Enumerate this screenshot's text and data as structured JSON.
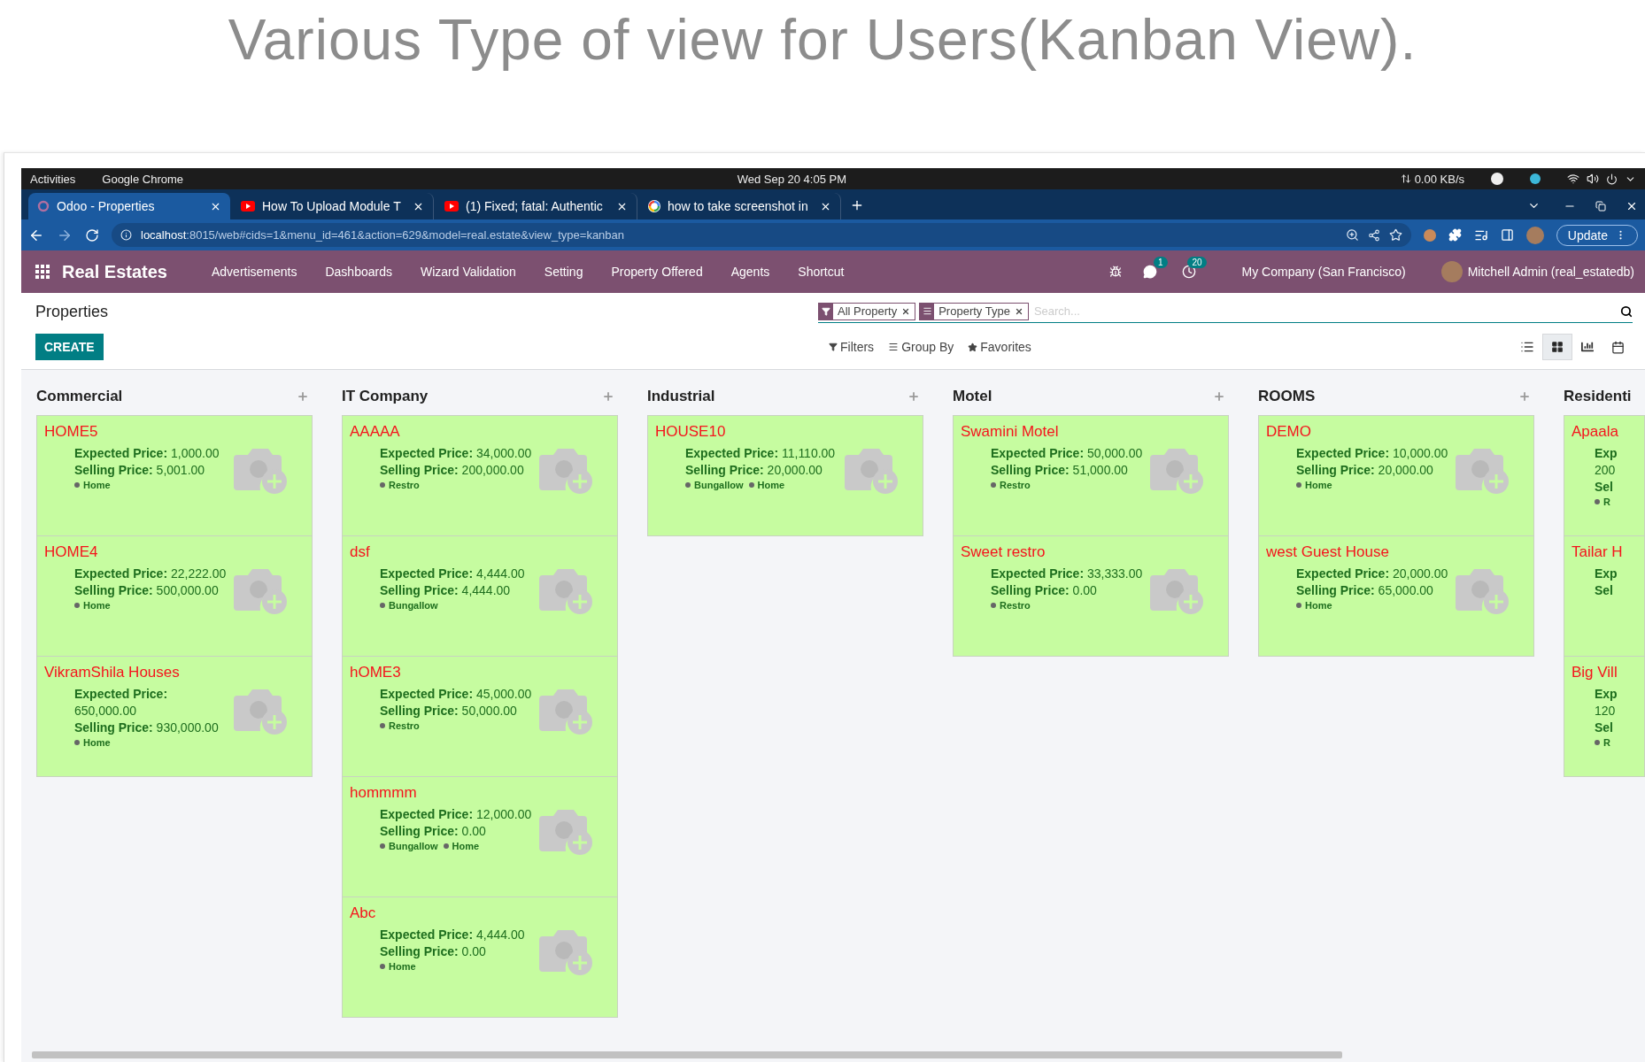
{
  "heading": "Various Type of view for Users(Kanban View).",
  "system_bar": {
    "activities": "Activities",
    "app": "Google Chrome",
    "datetime": "Wed Sep 20  4:05 PM",
    "network": "0.00 KB/s"
  },
  "browser_tabs": [
    {
      "title": "Odoo - Properties",
      "kind": "odoo",
      "selected": true
    },
    {
      "title": "How To Upload Module T",
      "kind": "youtube",
      "selected": false
    },
    {
      "title": "(1) Fixed; fatal: Authentic",
      "kind": "youtube",
      "selected": false
    },
    {
      "title": "how to take screenshot in",
      "kind": "google",
      "selected": false
    }
  ],
  "address": {
    "host": "localhost",
    "rest": ":8015/web#cids=1&menu_id=461&action=629&model=real.estate&view_type=kanban"
  },
  "update_button": "Update",
  "navbar": {
    "brand": "Real Estates",
    "menu": [
      "Advertisements",
      "Dashboards",
      "Wizard Validation",
      "Setting",
      "Property Offered",
      "Agents",
      "Shortcut"
    ],
    "messages_badge": "1",
    "activities_badge": "20",
    "company": "My Company (San Francisco)",
    "user": "Mitchell Admin (real_estatedb)"
  },
  "control_panel": {
    "breadcrumb": "Properties",
    "create": "CREATE",
    "facets": [
      {
        "kind": "filter",
        "label": "All Property"
      },
      {
        "kind": "group",
        "label": "Property Type"
      }
    ],
    "search": {
      "placeholder": "Search..."
    },
    "options": [
      {
        "kind": "filter",
        "label": "Filters"
      },
      {
        "kind": "group",
        "label": "Group By"
      },
      {
        "kind": "favorite",
        "label": "Favorites"
      }
    ],
    "views": [
      {
        "kind": "list",
        "selected": false
      },
      {
        "kind": "kanban",
        "selected": true
      },
      {
        "kind": "graph",
        "selected": false
      },
      {
        "kind": "calendar",
        "selected": false
      }
    ]
  },
  "columns": [
    {
      "title": "Commercial",
      "add_button": true,
      "cards": [
        {
          "name": "HOME5",
          "expected": {
            "label": "Expected Price:",
            "value": "1,000.00"
          },
          "selling": {
            "label": "Selling Price:",
            "value": "5,001.00"
          },
          "tags": [
            "Home"
          ],
          "photo_placeholder": true
        },
        {
          "name": "HOME4",
          "expected": {
            "label": "Expected Price:",
            "value": "22,222.00"
          },
          "selling": {
            "label": "Selling Price:",
            "value": "500,000.00"
          },
          "tags": [
            "Home"
          ],
          "photo_placeholder": true
        },
        {
          "name": "VikramShila Houses",
          "expected": {
            "label": "Expected Price:",
            "value": "650,000.00",
            "wrapped": true
          },
          "selling": {
            "label": "Selling Price:",
            "value": "930,000.00"
          },
          "tags": [
            "Home"
          ],
          "photo_placeholder": true
        }
      ]
    },
    {
      "title": "IT Company",
      "add_button": true,
      "cards": [
        {
          "name": "AAAAA",
          "expected": {
            "label": "Expected Price:",
            "value": "34,000.00"
          },
          "selling": {
            "label": "Selling Price:",
            "value": "200,000.00"
          },
          "tags": [
            "Restro"
          ],
          "photo_placeholder": true
        },
        {
          "name": "dsf",
          "expected": {
            "label": "Expected Price:",
            "value": "4,444.00"
          },
          "selling": {
            "label": "Selling Price:",
            "value": "4,444.00"
          },
          "tags": [
            "Bungallow"
          ],
          "photo_placeholder": true
        },
        {
          "name": "hOME3",
          "expected": {
            "label": "Expected Price:",
            "value": "45,000.00"
          },
          "selling": {
            "label": "Selling Price:",
            "value": "50,000.00"
          },
          "tags": [
            "Restro"
          ],
          "photo_placeholder": true
        },
        {
          "name": "hommmm",
          "expected": {
            "label": "Expected Price:",
            "value": "12,000.00"
          },
          "selling": {
            "label": "Selling Price:",
            "value": "0.00"
          },
          "tags": [
            "Bungallow",
            "Home"
          ],
          "photo_placeholder": true
        },
        {
          "name": "Abc",
          "expected": {
            "label": "Expected Price:",
            "value": "4,444.00"
          },
          "selling": {
            "label": "Selling Price:",
            "value": "0.00"
          },
          "tags": [
            "Home"
          ],
          "photo_placeholder": true
        }
      ]
    },
    {
      "title": "Industrial",
      "add_button": true,
      "cards": [
        {
          "name": "HOUSE10",
          "expected": {
            "label": "Expected Price:",
            "value": "11,110.00"
          },
          "selling": {
            "label": "Selling Price:",
            "value": "20,000.00"
          },
          "tags": [
            "Bungallow",
            "Home"
          ],
          "photo_placeholder": true
        }
      ]
    },
    {
      "title": "Motel",
      "add_button": true,
      "cards": [
        {
          "name": "Swamini Motel",
          "expected": {
            "label": "Expected Price:",
            "value": "50,000.00"
          },
          "selling": {
            "label": "Selling Price:",
            "value": "51,000.00"
          },
          "tags": [
            "Restro"
          ],
          "photo_placeholder": true
        },
        {
          "name": "Sweet restro",
          "expected": {
            "label": "Expected Price:",
            "value": "33,333.00"
          },
          "selling": {
            "label": "Selling Price:",
            "value": "0.00"
          },
          "tags": [
            "Restro"
          ],
          "photo_placeholder": true
        }
      ]
    },
    {
      "title": "ROOMS",
      "add_button": true,
      "cards": [
        {
          "name": "DEMO",
          "expected": {
            "label": "Expected Price:",
            "value": "10,000.00"
          },
          "selling": {
            "label": "Selling Price:",
            "value": "20,000.00"
          },
          "tags": [
            "Home"
          ],
          "photo_placeholder": true
        },
        {
          "name": "west Guest House",
          "expected": {
            "label": "Expected Price:",
            "value": "20,000.00"
          },
          "selling": {
            "label": "Selling Price:",
            "value": "65,000.00"
          },
          "tags": [
            "Home"
          ],
          "photo_placeholder": true
        }
      ]
    },
    {
      "title": "Residenti",
      "add_button": false,
      "cards": [
        {
          "name": "Apaala",
          "expected": {
            "label": "Exp",
            "value": "200",
            "wrapped": true
          },
          "selling": {
            "label": "Sel"
          },
          "tags": [
            "R"
          ],
          "photo_placeholder": false
        },
        {
          "name": "Tailar H",
          "expected": {
            "label": "Exp"
          },
          "selling": {
            "label": "Sel"
          },
          "photo_placeholder": false
        },
        {
          "name": "Big Vill",
          "expected": {
            "label": "Exp",
            "value": "120",
            "wrapped": true
          },
          "selling": {
            "label": "Sel"
          },
          "tags": [
            "R"
          ],
          "photo_placeholder": false
        }
      ]
    }
  ]
}
